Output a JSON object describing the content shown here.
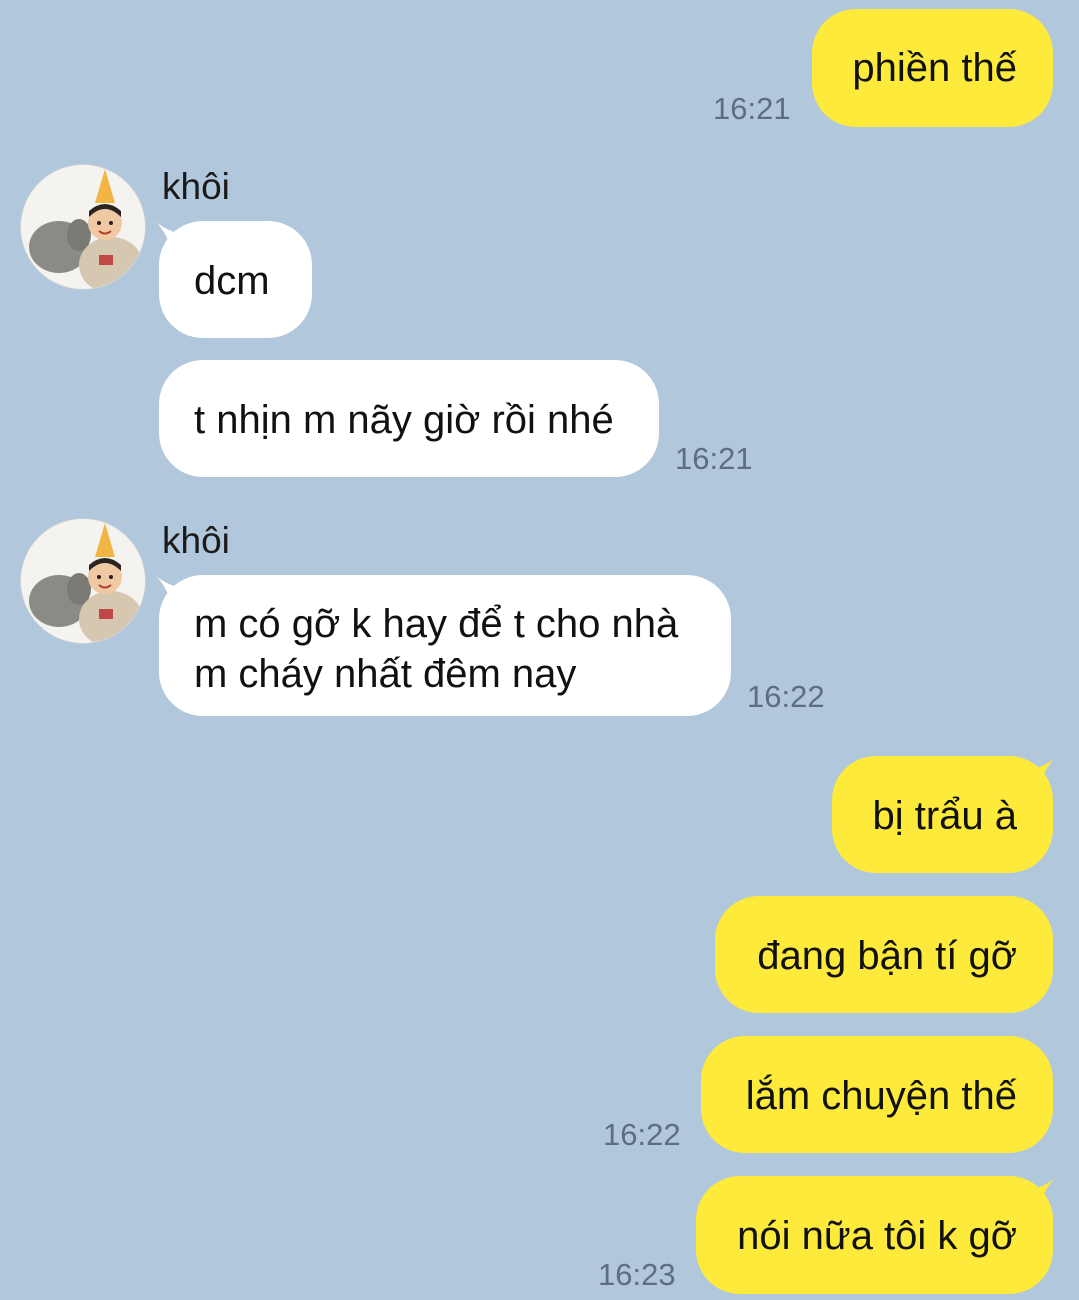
{
  "colors": {
    "background": "#b1c7dc",
    "outgoing_bubble": "#fdea3b",
    "incoming_bubble": "#ffffff",
    "timestamp": "#5e6e80"
  },
  "contact": {
    "name": "khôi",
    "avatar_icon": "child-with-party-hat-avatar"
  },
  "messages": [
    {
      "direction": "out",
      "text": "phiền thế",
      "time": "16:21"
    },
    {
      "direction": "in",
      "sender": "khôi",
      "text": "dcm"
    },
    {
      "direction": "in",
      "text": "t nhịn m nãy giờ rồi nhé",
      "time": "16:21"
    },
    {
      "direction": "in",
      "sender": "khôi",
      "lines": [
        "m có gỡ k hay để t cho nhà",
        "m cháy nhất đêm nay"
      ],
      "time": "16:22"
    },
    {
      "direction": "out",
      "text": "bị trẩu à"
    },
    {
      "direction": "out",
      "text": "đang bận tí gỡ"
    },
    {
      "direction": "out",
      "text": "lắm chuyện thế",
      "time": "16:22"
    },
    {
      "direction": "out",
      "text": "nói nữa tôi k gỡ",
      "time": "16:23"
    }
  ]
}
